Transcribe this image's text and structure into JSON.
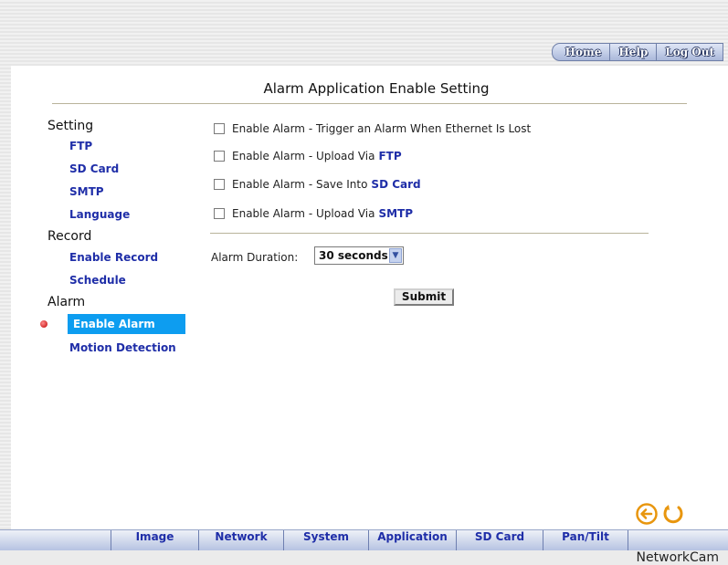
{
  "top_nav": [
    "Home",
    "Help",
    "Log Out"
  ],
  "page_title": "Alarm Application Enable Setting",
  "sidebar": {
    "setting_label": "Setting",
    "setting_items": [
      "FTP",
      "SD Card",
      "SMTP",
      "Language"
    ],
    "record_label": "Record",
    "record_items": [
      "Enable Record",
      "Schedule"
    ],
    "alarm_label": "Alarm",
    "alarm_items": [
      "Enable Alarm",
      "Motion Detection"
    ],
    "active_item": "Enable Alarm"
  },
  "options": [
    {
      "text": "Enable Alarm - Trigger an Alarm When Ethernet Is Lost",
      "keyword": "",
      "checked": false
    },
    {
      "text": "Enable Alarm - Upload Via",
      "keyword": "FTP",
      "checked": false
    },
    {
      "text": "Enable Alarm - Save Into",
      "keyword": "SD Card",
      "checked": false
    },
    {
      "text": "Enable Alarm - Upload Via",
      "keyword": "SMTP",
      "checked": false
    }
  ],
  "duration": {
    "label": "Alarm Duration:",
    "value": "30 seconds"
  },
  "submit_label": "Submit",
  "bottom_nav": [
    "Image",
    "Network",
    "System",
    "Application",
    "SD Card",
    "Pan/Tilt"
  ],
  "brand": "NetworkCam",
  "colors": {
    "accent": "#0d9df0",
    "link": "#1f2ea8",
    "icon_orange": "#e8960e"
  }
}
